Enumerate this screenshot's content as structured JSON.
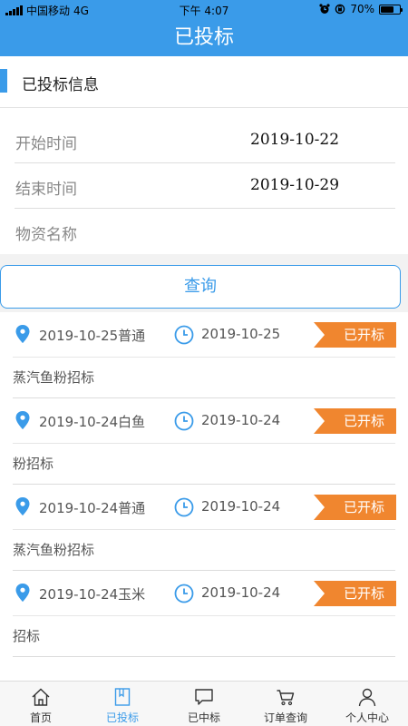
{
  "status_bar": {
    "carrier": "中国移动",
    "network": "4G",
    "time": "下午 4:07",
    "battery": "70%",
    "battery_level": 0.7
  },
  "nav": {
    "title": "已投标"
  },
  "section": {
    "title": "已投标信息"
  },
  "form": {
    "start_label": "开始时间",
    "start_value": "2019-10-22",
    "end_label": "结束时间",
    "end_value": "2019-10-29",
    "material_label": "物资名称",
    "material_value": ""
  },
  "query_button": "查询",
  "bids": [
    {
      "title_a": "2019-10-25普通",
      "title_b": "蒸汽鱼粉招标",
      "date": "2019-10-25",
      "status": "已开标"
    },
    {
      "title_a": "2019-10-24白鱼",
      "title_b": "粉招标",
      "date": "2019-10-24",
      "status": "已开标"
    },
    {
      "title_a": "2019-10-24普通",
      "title_b": "蒸汽鱼粉招标",
      "date": "2019-10-24",
      "status": "已开标"
    },
    {
      "title_a": "2019-10-24玉米",
      "title_b": "招标",
      "date": "2019-10-24",
      "status": "已开标"
    }
  ],
  "tabs": [
    {
      "label": "首页",
      "icon": "home-icon"
    },
    {
      "label": "已投标",
      "icon": "bookmark-icon"
    },
    {
      "label": "已中标",
      "icon": "chat-bubble-icon"
    },
    {
      "label": "订单查询",
      "icon": "cart-icon"
    },
    {
      "label": "个人中心",
      "icon": "person-icon"
    }
  ],
  "colors": {
    "primary": "#3a9be9",
    "tag": "#f0862f"
  }
}
